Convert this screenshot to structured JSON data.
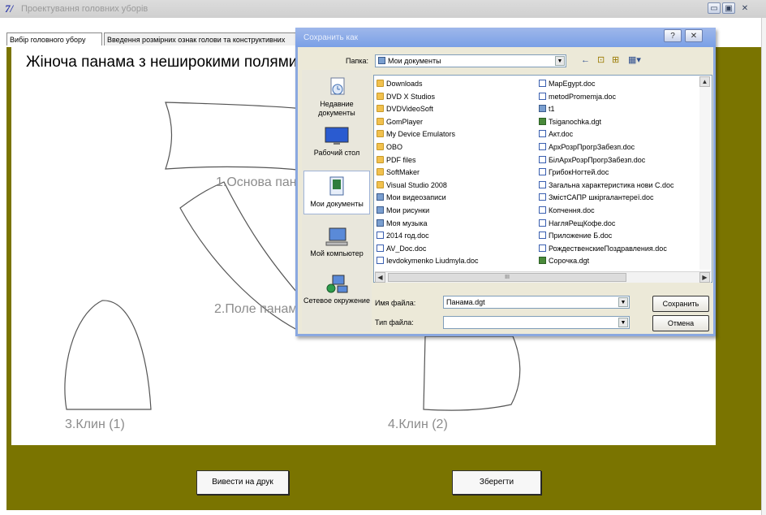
{
  "window": {
    "logo": "7/",
    "title": "Проектування головних уборів",
    "controls": {
      "minimize": "▭",
      "maximize": "▣",
      "close": "✕"
    }
  },
  "tabs": [
    {
      "label": "Вибір головного убору"
    },
    {
      "label": "Введення розмірних ознак голови та конструктивних"
    }
  ],
  "canvas": {
    "heading": "Жіноча панама з неширокими полями",
    "parts": [
      {
        "label": "1.Основа пан"
      },
      {
        "label": "2.Поле панам"
      },
      {
        "label": "3.Клин (1)"
      },
      {
        "label": "4.Клин (2)"
      }
    ]
  },
  "buttons": {
    "print": "Вивести на друк",
    "save": "Зберегти"
  },
  "dialog": {
    "title": "Сохранить как",
    "help": "?",
    "close": "✕",
    "folder_label": "Папка:",
    "folder_value": "Мои документы",
    "toolbar": {
      "back": "←",
      "up": "⊡",
      "new_folder": "⊞",
      "view": "▦▾"
    },
    "places": [
      {
        "label": "Недавние документы",
        "icon": "recent-documents-icon"
      },
      {
        "label": "Рабочий стол",
        "icon": "desktop-icon"
      },
      {
        "label": "Мои документы",
        "icon": "my-documents-icon"
      },
      {
        "label": "Мой компьютер",
        "icon": "my-computer-icon"
      },
      {
        "label": "Сетевое окружение",
        "icon": "network-places-icon"
      }
    ],
    "files_left": [
      {
        "name": "Downloads",
        "type": "folder"
      },
      {
        "name": "DVD X Studios",
        "type": "folder"
      },
      {
        "name": "DVDVideoSoft",
        "type": "folder"
      },
      {
        "name": "GomPlayer",
        "type": "folder"
      },
      {
        "name": "My Device Emulators",
        "type": "folder"
      },
      {
        "name": "OBO",
        "type": "folder"
      },
      {
        "name": "PDF files",
        "type": "folder"
      },
      {
        "name": "SoftMaker",
        "type": "folder"
      },
      {
        "name": "Visual Studio 2008",
        "type": "folder"
      },
      {
        "name": "Мои видеозаписи",
        "type": "sys"
      },
      {
        "name": "Мои рисунки",
        "type": "sys"
      },
      {
        "name": "Моя музыка",
        "type": "sys"
      },
      {
        "name": "2014 год.doc",
        "type": "doc"
      },
      {
        "name": "AV_Doc.doc",
        "type": "doc"
      },
      {
        "name": "Ievdokymenko Liudmyla.doc",
        "type": "doc"
      }
    ],
    "files_right": [
      {
        "name": "MapEgypt.doc",
        "type": "doc"
      },
      {
        "name": "metodPromemja.doc",
        "type": "doc"
      },
      {
        "name": "t1",
        "type": "sys"
      },
      {
        "name": "Tsiganochka.dgt",
        "type": "dgt"
      },
      {
        "name": "Акт.doc",
        "type": "doc"
      },
      {
        "name": "АрхРозрПрогрЗабезп.doc",
        "type": "doc"
      },
      {
        "name": "БілАрхРозрПрогрЗабезп.doc",
        "type": "doc"
      },
      {
        "name": "ГрибокНогтей.doc",
        "type": "doc"
      },
      {
        "name": "Загальна характеристика нови С.doc",
        "type": "doc"
      },
      {
        "name": "ЗмістСАПР шкіргалантереї.doc",
        "type": "doc"
      },
      {
        "name": "Копчення.doc",
        "type": "doc"
      },
      {
        "name": "НагляРещКофе.doc",
        "type": "doc"
      },
      {
        "name": "Приложение Б.doc",
        "type": "doc"
      },
      {
        "name": "РождественскиеПоздравления.doc",
        "type": "doc"
      },
      {
        "name": "Сорочка.dgt",
        "type": "dgt"
      }
    ],
    "filename_label": "Имя файла:",
    "filename_value": "Панама.dgt",
    "filetype_label": "Тип файла:",
    "filetype_value": "",
    "save_button": "Сохранить",
    "cancel_button": "Отмена",
    "hscroll_thumb": "III"
  }
}
